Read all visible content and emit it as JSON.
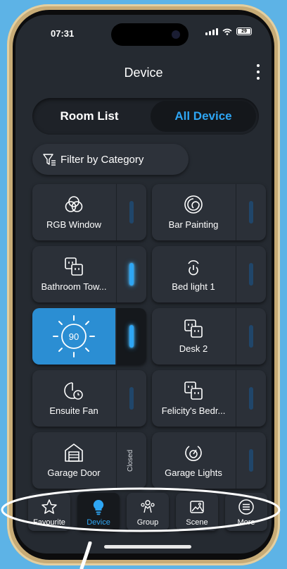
{
  "status": {
    "time": "07:31",
    "battery": "29"
  },
  "header": {
    "title": "Device",
    "menu_icon": "more-vertical-icon"
  },
  "segment": {
    "options": [
      "Room List",
      "All Device"
    ],
    "selected": "All Device",
    "accent": "#2ea6f4"
  },
  "filter": {
    "label": "Filter by Category",
    "icon": "filter-icon"
  },
  "devices": [
    {
      "name": "RGB Window",
      "icon": "rgb-icon",
      "on": false
    },
    {
      "name": "Bar Painting",
      "icon": "swirl-icon",
      "on": false
    },
    {
      "name": "Bathroom Tow...",
      "icon": "outlet-icon",
      "on": true
    },
    {
      "name": "Bed light 1",
      "icon": "lamp-power-icon",
      "on": false
    },
    {
      "name": "90",
      "icon": "sun-dimmer-icon",
      "on": true,
      "active": true
    },
    {
      "name": "Desk 2",
      "icon": "outlet-icon",
      "on": false
    },
    {
      "name": "Ensuite Fan",
      "icon": "timer-fan-icon",
      "on": false
    },
    {
      "name": "Felicity's Bedr...",
      "icon": "outlet-icon",
      "on": false
    },
    {
      "name": "Garage Door",
      "icon": "garage-icon",
      "status": "Closed"
    },
    {
      "name": "Garage Lights",
      "icon": "gauge-icon",
      "on": false
    }
  ],
  "nav": [
    {
      "label": "Favourite",
      "icon": "star-icon"
    },
    {
      "label": "Device",
      "icon": "bulb-icon",
      "active": true
    },
    {
      "label": "Group",
      "icon": "group-icon"
    },
    {
      "label": "Scene",
      "icon": "image-icon"
    },
    {
      "label": "More",
      "icon": "more-list-icon"
    }
  ]
}
